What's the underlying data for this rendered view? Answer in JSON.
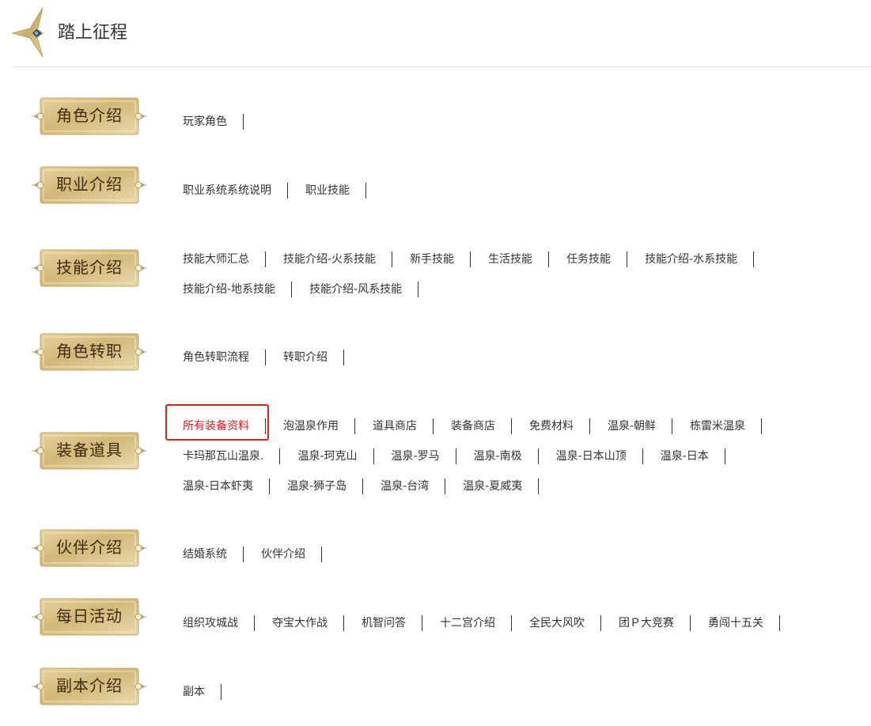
{
  "header": {
    "title": "踏上征程"
  },
  "sections": [
    {
      "badge": "角色介绍",
      "lines": [
        [
          "玩家角色"
        ]
      ]
    },
    {
      "badge": "职业介绍",
      "lines": [
        [
          "职业系统系统说明",
          "职业技能"
        ]
      ]
    },
    {
      "badge": "技能介绍",
      "lines": [
        [
          "技能大师汇总",
          "技能介绍-火系技能",
          "新手技能",
          "生活技能",
          "任务技能",
          "技能介绍-水系技能"
        ],
        [
          "技能介绍-地系技能",
          "技能介绍-风系技能"
        ]
      ]
    },
    {
      "badge": "角色转职",
      "lines": [
        [
          "角色转职流程",
          "转职介绍"
        ]
      ]
    },
    {
      "badge": "装备道具",
      "lines": [
        [
          "所有装备资料",
          "泡温泉作用",
          "道具商店",
          "装备商店",
          "免费材料",
          "温泉-朝鲜",
          "栋雷米温泉"
        ],
        [
          "卡玛那瓦山温泉.",
          "温泉-珂克山",
          "温泉-罗马",
          "温泉-南极",
          "温泉-日本山顶",
          "温泉-日本"
        ],
        [
          "温泉-日本虾夷",
          "温泉-狮子岛",
          "温泉-台湾",
          "温泉-夏威夷"
        ]
      ]
    },
    {
      "badge": "伙伴介绍",
      "lines": [
        [
          "结婚系统",
          "伙伴介绍"
        ]
      ]
    },
    {
      "badge": "每日活动",
      "lines": [
        [
          "组织攻城战",
          "夺宝大作战",
          "机智问答",
          "十二宫介绍",
          "全民大风吹",
          "团Ｐ大竞赛",
          "勇闯十五关"
        ]
      ]
    },
    {
      "badge": "副本介绍",
      "lines": [
        [
          "副本"
        ]
      ]
    }
  ],
  "highlight": {
    "section": 4,
    "line": 0,
    "item": 0
  },
  "colors": {
    "highlight_text": "#cc2222",
    "highlight_border": "#e02020",
    "badge_gold": "#d9c28c"
  }
}
